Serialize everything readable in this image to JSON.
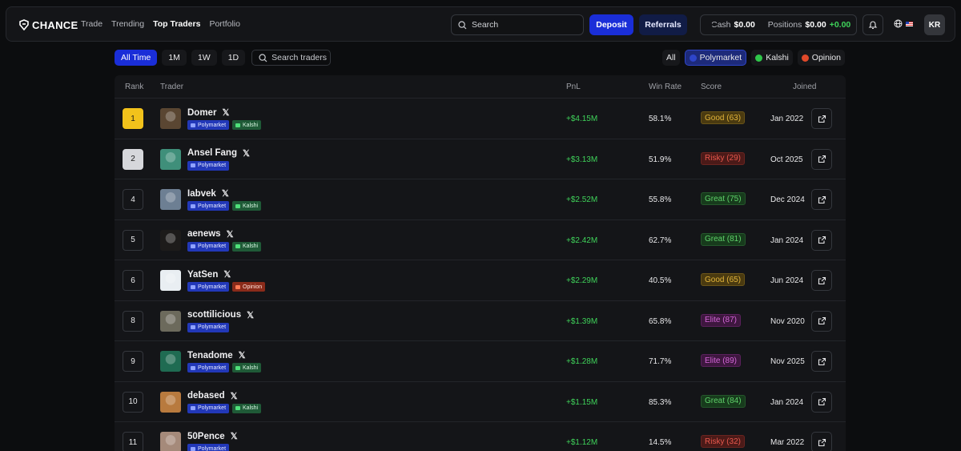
{
  "brand": {
    "name": "CHANCE"
  },
  "nav": [
    {
      "label": "Trade",
      "active": false
    },
    {
      "label": "Trending",
      "active": false
    },
    {
      "label": "Top Traders",
      "active": true
    },
    {
      "label": "Portfolio",
      "active": false
    }
  ],
  "header": {
    "search_placeholder": "Search",
    "deposit_label": "Deposit",
    "referrals_label": "Referrals",
    "cash_label": "Cash",
    "cash_value": "$0.00",
    "positions_label": "Positions",
    "positions_value": "$0.00",
    "positions_change": "+0.00",
    "user_initials": "KR"
  },
  "time_filters": [
    {
      "label": "All Time",
      "active": true
    },
    {
      "label": "1M",
      "active": false
    },
    {
      "label": "1W",
      "active": false
    },
    {
      "label": "1D",
      "active": false
    }
  ],
  "trader_search_placeholder": "Search traders",
  "platform_filters": [
    {
      "label": "All",
      "active": false,
      "icon": "none"
    },
    {
      "label": "Polymarket",
      "active": true,
      "icon": "polymarket-icon"
    },
    {
      "label": "Kalshi",
      "active": false,
      "icon": "kalshi-icon"
    },
    {
      "label": "Opinion",
      "active": false,
      "icon": "opinion-icon"
    }
  ],
  "table": {
    "columns": {
      "rank": "Rank",
      "trader": "Trader",
      "pnl": "PnL",
      "win_rate": "Win Rate",
      "score": "Score",
      "joined": "Joined"
    },
    "rows": [
      {
        "rank": "1",
        "name": "Domer",
        "platforms": [
          "Polymarket",
          "Kalshi"
        ],
        "pnl": "+$4.15M",
        "win_rate": "58.1%",
        "score": "Good (63)",
        "score_class": "good",
        "joined": "Jan 2022",
        "avatar_color": "#5a4632"
      },
      {
        "rank": "2",
        "name": "Ansel Fang",
        "platforms": [
          "Polymarket"
        ],
        "pnl": "+$3.13M",
        "win_rate": "51.9%",
        "score": "Risky (29)",
        "score_class": "risky",
        "joined": "Oct 2025",
        "avatar_color": "#3f8f7a"
      },
      {
        "rank": "4",
        "name": "Iabvek",
        "platforms": [
          "Polymarket",
          "Kalshi"
        ],
        "pnl": "+$2.52M",
        "win_rate": "55.8%",
        "score": "Great (75)",
        "score_class": "great",
        "joined": "Dec 2024",
        "avatar_color": "#6d7f93"
      },
      {
        "rank": "5",
        "name": "aenews",
        "platforms": [
          "Polymarket",
          "Kalshi"
        ],
        "pnl": "+$2.42M",
        "win_rate": "62.7%",
        "score": "Great (81)",
        "score_class": "great",
        "joined": "Jan 2024",
        "avatar_color": "#1d1b1a"
      },
      {
        "rank": "6",
        "name": "YatSen",
        "platforms": [
          "Polymarket",
          "Opinion"
        ],
        "pnl": "+$2.29M",
        "win_rate": "40.5%",
        "score": "Good (65)",
        "score_class": "good",
        "joined": "Jun 2024",
        "avatar_color": "#e9eef2"
      },
      {
        "rank": "8",
        "name": "scottilicious",
        "platforms": [
          "Polymarket"
        ],
        "pnl": "+$1.39M",
        "win_rate": "65.8%",
        "score": "Elite (87)",
        "score_class": "elite",
        "joined": "Nov 2020",
        "avatar_color": "#6c6a5c"
      },
      {
        "rank": "9",
        "name": "Tenadome",
        "platforms": [
          "Polymarket",
          "Kalshi"
        ],
        "pnl": "+$1.28M",
        "win_rate": "71.7%",
        "score": "Elite (89)",
        "score_class": "elite",
        "joined": "Nov 2025",
        "avatar_color": "#1f6b52"
      },
      {
        "rank": "10",
        "name": "debased",
        "platforms": [
          "Polymarket",
          "Kalshi"
        ],
        "pnl": "+$1.15M",
        "win_rate": "85.3%",
        "score": "Great (84)",
        "score_class": "great",
        "joined": "Jan 2024",
        "avatar_color": "#b87a3e"
      },
      {
        "rank": "11",
        "name": "50Pence",
        "platforms": [
          "Polymarket"
        ],
        "pnl": "+$1.12M",
        "win_rate": "14.5%",
        "score": "Risky (32)",
        "score_class": "risky",
        "joined": "Mar 2022",
        "avatar_color": "#a58a7a"
      }
    ]
  },
  "colors": {
    "accent": "#1a2ed8",
    "positive": "#3fd35a",
    "gold": "#f2c21b",
    "silver": "#d6d7db"
  }
}
